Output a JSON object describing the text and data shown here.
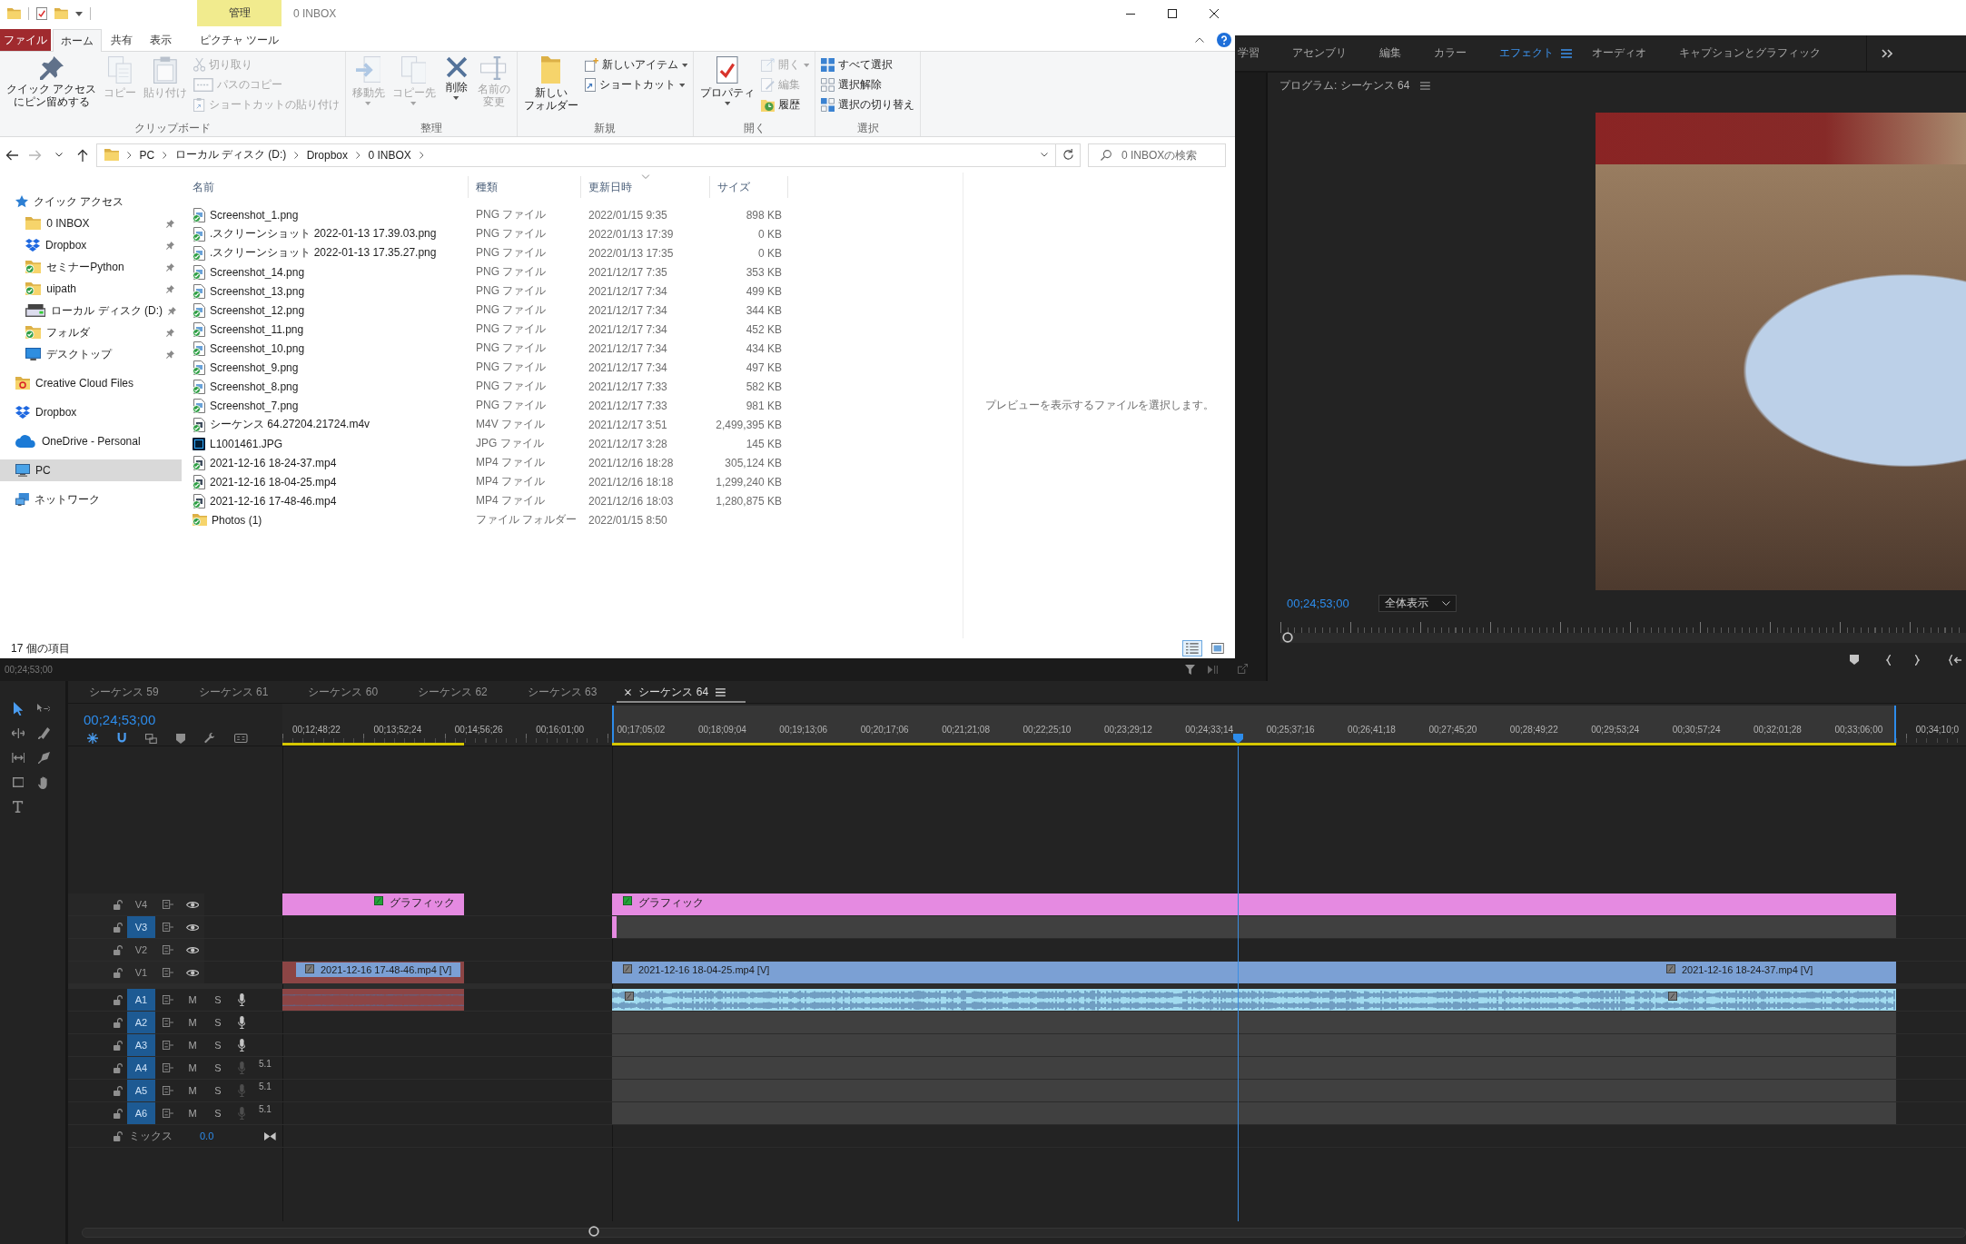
{
  "explorer": {
    "title_bar": {
      "context_tab": "管理",
      "title": "0 INBOX"
    },
    "ribbon_tabs": [
      {
        "label": "ファイル",
        "kind": "file",
        "selected": false
      },
      {
        "label": "ホーム",
        "kind": "tab",
        "selected": true
      },
      {
        "label": "共有",
        "kind": "tab",
        "selected": false
      },
      {
        "label": "表示",
        "kind": "tab",
        "selected": false
      },
      {
        "label": "ピクチャ ツール",
        "kind": "context",
        "selected": false
      }
    ],
    "ribbon_groups": [
      {
        "label": "クリップボード",
        "large": [
          {
            "lines": [
              "クイック アクセス",
              "にピン留めする"
            ],
            "disabled": false,
            "has_menu": false
          },
          {
            "lines": [
              "コピー"
            ],
            "disabled": true,
            "has_menu": false
          },
          {
            "lines": [
              "貼り付け"
            ],
            "disabled": true,
            "has_menu": false
          }
        ],
        "small": [
          {
            "label": "切り取り",
            "disabled": true,
            "has_menu": false
          },
          {
            "label": "パスのコピー",
            "disabled": true,
            "has_menu": false
          },
          {
            "label": "ショートカットの貼り付け",
            "disabled": true,
            "has_menu": false
          }
        ]
      },
      {
        "label": "整理",
        "large": [
          {
            "lines": [
              "移動先"
            ],
            "disabled": true,
            "has_menu": true
          },
          {
            "lines": [
              "コピー先"
            ],
            "disabled": true,
            "has_menu": true
          },
          {
            "lines": [
              "削除"
            ],
            "disabled": false,
            "has_menu": true
          },
          {
            "lines": [
              "名前の",
              "変更"
            ],
            "disabled": true,
            "has_menu": false
          }
        ]
      },
      {
        "label": "新規",
        "large": [
          {
            "lines": [
              "新しい",
              "フォルダー"
            ],
            "disabled": false,
            "has_menu": false
          }
        ],
        "small": [
          {
            "label": "新しいアイテム",
            "disabled": false,
            "has_menu": true
          },
          {
            "label": "ショートカット",
            "disabled": false,
            "has_menu": true
          }
        ]
      },
      {
        "label": "開く",
        "large": [
          {
            "lines": [
              "プロパティ"
            ],
            "disabled": false,
            "has_menu": true
          }
        ],
        "small": [
          {
            "label": "開く",
            "disabled": true,
            "has_menu": true
          },
          {
            "label": "編集",
            "disabled": true,
            "has_menu": false
          },
          {
            "label": "履歴",
            "disabled": false,
            "has_menu": false
          }
        ]
      },
      {
        "label": "選択",
        "small": [
          {
            "label": "すべて選択",
            "disabled": false,
            "has_menu": false
          },
          {
            "label": "選択解除",
            "disabled": false,
            "has_menu": false
          },
          {
            "label": "選択の切り替え",
            "disabled": false,
            "has_menu": false
          }
        ]
      }
    ],
    "nav_buttons": [
      {
        "disabled": false
      },
      {
        "disabled": true
      },
      {
        "disabled": false
      },
      {
        "disabled": false
      }
    ],
    "address": {
      "path": [
        "PC",
        "ローカル ディスク (D:)",
        "Dropbox",
        "0 INBOX"
      ]
    },
    "search": {
      "placeholder": "0 INBOXの検索"
    },
    "nav": [
      {
        "label": "クイック アクセス",
        "kind": "star",
        "selected": false,
        "children": [
          {
            "label": "0 INBOX",
            "kind": "folder",
            "synced": false,
            "pinned": true,
            "selected": false
          },
          {
            "label": "Dropbox",
            "kind": "dropbox",
            "synced": false,
            "pinned": true,
            "selected": false
          },
          {
            "label": "セミナーPython",
            "kind": "folder",
            "synced": true,
            "pinned": true,
            "selected": false
          },
          {
            "label": "uipath",
            "kind": "folder",
            "synced": true,
            "pinned": true,
            "selected": false
          },
          {
            "label": "ローカル ディスク (D:)",
            "kind": "drive",
            "synced": false,
            "pinned": true,
            "selected": false
          },
          {
            "label": "フォルダ",
            "kind": "folder",
            "synced": true,
            "pinned": true,
            "selected": false
          },
          {
            "label": "デスクトップ",
            "kind": "desktop",
            "synced": false,
            "pinned": true,
            "selected": false
          }
        ]
      },
      {
        "label": "Creative Cloud Files",
        "kind": "cloud-folder",
        "selected": false
      },
      {
        "label": "Dropbox",
        "kind": "dropbox",
        "selected": false
      },
      {
        "label": "OneDrive - Personal",
        "kind": "onedrive",
        "selected": false
      },
      {
        "label": "PC",
        "kind": "pc",
        "selected": true
      },
      {
        "label": "ネットワーク",
        "kind": "network",
        "selected": false
      }
    ],
    "columns": [
      {
        "label": "名前",
        "sorted": false
      },
      {
        "label": "種類",
        "sorted": false
      },
      {
        "label": "更新日時",
        "sorted": true
      },
      {
        "label": "サイズ",
        "sorted": false
      }
    ],
    "files": [
      {
        "name": "Screenshot_1.png",
        "type": "PNG ファイル",
        "date": "2022/01/15 9:35",
        "size": "898 KB",
        "kind": "image",
        "synced": true
      },
      {
        "name": ".スクリーンショット 2022-01-13 17.39.03.png",
        "type": "PNG ファイル",
        "date": "2022/01/13 17:39",
        "size": "0 KB",
        "kind": "image",
        "synced": true
      },
      {
        "name": ".スクリーンショット 2022-01-13 17.35.27.png",
        "type": "PNG ファイル",
        "date": "2022/01/13 17:35",
        "size": "0 KB",
        "kind": "image",
        "synced": true
      },
      {
        "name": "Screenshot_14.png",
        "type": "PNG ファイル",
        "date": "2021/12/17 7:35",
        "size": "353 KB",
        "kind": "image",
        "synced": true
      },
      {
        "name": "Screenshot_13.png",
        "type": "PNG ファイル",
        "date": "2021/12/17 7:34",
        "size": "499 KB",
        "kind": "image",
        "synced": true
      },
      {
        "name": "Screenshot_12.png",
        "type": "PNG ファイル",
        "date": "2021/12/17 7:34",
        "size": "344 KB",
        "kind": "image",
        "synced": true
      },
      {
        "name": "Screenshot_11.png",
        "type": "PNG ファイル",
        "date": "2021/12/17 7:34",
        "size": "452 KB",
        "kind": "image",
        "synced": true
      },
      {
        "name": "Screenshot_10.png",
        "type": "PNG ファイル",
        "date": "2021/12/17 7:34",
        "size": "434 KB",
        "kind": "image",
        "synced": true
      },
      {
        "name": "Screenshot_9.png",
        "type": "PNG ファイル",
        "date": "2021/12/17 7:34",
        "size": "497 KB",
        "kind": "image",
        "synced": true
      },
      {
        "name": "Screenshot_8.png",
        "type": "PNG ファイル",
        "date": "2021/12/17 7:33",
        "size": "582 KB",
        "kind": "image",
        "synced": true
      },
      {
        "name": "Screenshot_7.png",
        "type": "PNG ファイル",
        "date": "2021/12/17 7:33",
        "size": "981 KB",
        "kind": "image",
        "synced": true
      },
      {
        "name": "シーケンス 64.27204.21724.m4v",
        "type": "M4V ファイル",
        "date": "2021/12/17 3:51",
        "size": "2,499,395 KB",
        "kind": "video",
        "synced": true
      },
      {
        "name": "L1001461.JPG",
        "type": "JPG ファイル",
        "date": "2021/12/17 3:28",
        "size": "145 KB",
        "kind": "photoshop",
        "synced": false
      },
      {
        "name": "2021-12-16 18-24-37.mp4",
        "type": "MP4 ファイル",
        "date": "2021/12/16 18:28",
        "size": "305,124 KB",
        "kind": "video",
        "synced": true
      },
      {
        "name": "2021-12-16 18-04-25.mp4",
        "type": "MP4 ファイル",
        "date": "2021/12/16 18:18",
        "size": "1,299,240 KB",
        "kind": "video",
        "synced": true
      },
      {
        "name": "2021-12-16 17-48-46.mp4",
        "type": "MP4 ファイル",
        "date": "2021/12/16 18:03",
        "size": "1,280,875 KB",
        "kind": "video",
        "synced": true
      },
      {
        "name": "Photos (1)",
        "type": "ファイル フォルダー",
        "date": "2022/01/15 8:50",
        "kind": "folder",
        "synced": true
      }
    ],
    "preview_message": "プレビューを表示するファイルを選択します。",
    "status_bar": {
      "count": "17 個の項目",
      "views": [
        {
          "kind": "details",
          "selected": true
        },
        {
          "kind": "thumbnails",
          "selected": false
        }
      ]
    }
  },
  "premiere": {
    "source_timecode": "00;24;53;00",
    "workspaces": [
      {
        "label": "学習",
        "selected": false
      },
      {
        "label": "アセンブリ",
        "selected": false
      },
      {
        "label": "編集",
        "selected": false
      },
      {
        "label": "カラー",
        "selected": false
      },
      {
        "label": "エフェクト",
        "selected": true
      },
      {
        "label": "オーディオ",
        "selected": false
      },
      {
        "label": "キャプションとグラフィック",
        "selected": false
      }
    ],
    "program_monitor": {
      "title": "プログラム: シーケンス 64",
      "timecode": "00;24;53;00",
      "zoom": "全体表示",
      "scrubber": {
        "level": 0.01
      }
    },
    "timeline": {
      "tools": [
        {
          "selected": true
        },
        {
          "selected": false
        },
        {
          "selected": false
        },
        {
          "selected": false
        },
        {
          "selected": false
        },
        {
          "selected": false
        },
        {
          "selected": false
        },
        {
          "selected": false
        },
        {
          "selected": false
        }
      ],
      "tabs": [
        {
          "label": "シーケンス 59",
          "selected": false
        },
        {
          "label": "シーケンス 61",
          "selected": false
        },
        {
          "label": "シーケンス 60",
          "selected": false
        },
        {
          "label": "シーケンス 62",
          "selected": false
        },
        {
          "label": "シーケンス 63",
          "selected": false
        },
        {
          "label": "シーケンス 64",
          "selected": true
        }
      ],
      "timecode": "00;24;53;00",
      "header_toggles": [
        {
          "on": true
        },
        {
          "on": true
        },
        {
          "on": false
        },
        {
          "on": false
        },
        {
          "on": false
        },
        {
          "on": false
        }
      ],
      "ruler": [
        "00;12;48;22",
        "00;13;52;24",
        "00;14;56;26",
        "00;16;01;00",
        "00;17;05;02",
        "00;18;09;04",
        "00;19;13;06",
        "00;20;17;06",
        "00;21;21;08",
        "00;22;25;10",
        "00;23;29;12",
        "00;24;33;14",
        "00;25;37;16",
        "00;26;41;18",
        "00;27;45;20",
        "00;28;49;22",
        "00;29;53;24",
        "00;30;57;24",
        "00;32;01;28",
        "00;33;06;00",
        "00;34;10;0"
      ],
      "video_tracks": [
        {
          "label": "V4",
          "targeted": false,
          "clips": [
            {
              "kind": "graphic",
              "label": "グラフィック",
              "color": "#e58ae1"
            },
            {
              "kind": "graphic",
              "label": "グラフィック",
              "color": "#e58ae1"
            }
          ]
        },
        {
          "label": "V3",
          "targeted": true,
          "clips": [
            {
              "kind": "graphic",
              "color": "#e58ae1"
            }
          ]
        },
        {
          "label": "V2",
          "targeted": false
        },
        {
          "label": "V1",
          "targeted": false,
          "clips": [
            {
              "kind": "video",
              "label": "2021-12-16 17-48-46.mp4 [V]",
              "color": "#8c4545"
            },
            {
              "kind": "video",
              "label": "2021-12-16 18-04-25.mp4 [V]",
              "color": "#7ba0d4"
            },
            {
              "kind": "video",
              "label": "2021-12-16 18-24-37.mp4 [V]",
              "color": "#7ba0d4"
            }
          ]
        }
      ],
      "audio_tracks": [
        {
          "label": "A1",
          "targeted": true,
          "mute": "M",
          "solo": "S",
          "mic_active": true,
          "clips": [
            {
              "kind": "audio",
              "color": "#8c4545"
            },
            {
              "kind": "audio",
              "color": "#a2dcf0"
            },
            {
              "kind": "audio",
              "color": "#a2dcf0"
            }
          ]
        },
        {
          "label": "A2",
          "targeted": true,
          "mute": "M",
          "solo": "S",
          "mic_active": true
        },
        {
          "label": "A3",
          "targeted": true,
          "mute": "M",
          "solo": "S",
          "mic_active": true
        },
        {
          "label": "A4",
          "targeted": true,
          "mute": "M",
          "solo": "S",
          "mic_active": false,
          "channels": "5.1"
        },
        {
          "label": "A5",
          "targeted": true,
          "mute": "M",
          "solo": "S",
          "mic_active": false,
          "channels": "5.1"
        },
        {
          "label": "A6",
          "targeted": true,
          "mute": "M",
          "solo": "S",
          "mic_active": false,
          "channels": "5.1"
        }
      ],
      "mix": {
        "label": "ミックス",
        "value": "0.0"
      }
    }
  }
}
